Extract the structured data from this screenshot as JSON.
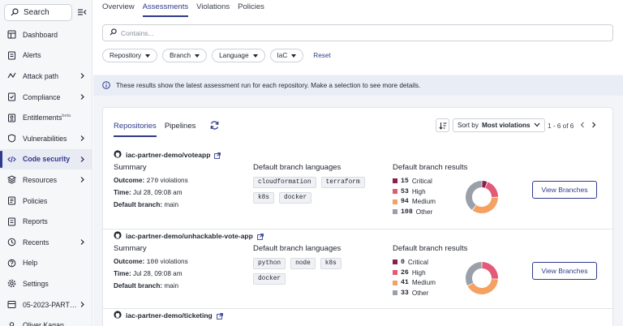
{
  "sidebar": {
    "search_label": "Search",
    "items": [
      {
        "label": "Dashboard",
        "icon": "dashboard-icon",
        "chevron": false
      },
      {
        "label": "Alerts",
        "icon": "alerts-icon",
        "chevron": false
      },
      {
        "label": "Attack path",
        "icon": "attack-path-icon",
        "chevron": true
      },
      {
        "label": "Compliance",
        "icon": "compliance-icon",
        "chevron": true
      },
      {
        "label": "Entitlements",
        "icon": "entitlements-icon",
        "chevron": false,
        "badge": "beta"
      },
      {
        "label": "Vulnerabilities",
        "icon": "vulnerabilities-icon",
        "chevron": true
      },
      {
        "label": "Code security",
        "icon": "code-icon",
        "chevron": true,
        "active": true
      },
      {
        "label": "Resources",
        "icon": "resources-icon",
        "chevron": true
      },
      {
        "label": "Policies",
        "icon": "policies-icon",
        "chevron": false
      },
      {
        "label": "Reports",
        "icon": "reports-icon",
        "chevron": false
      },
      {
        "label": "Recents",
        "icon": "recents-icon",
        "chevron": true
      },
      {
        "label": "Help",
        "icon": "help-icon",
        "chevron": false
      },
      {
        "label": "Settings",
        "icon": "settings-icon",
        "chevron": false
      },
      {
        "label": "05-2023-PART…",
        "icon": "tenant-icon",
        "chevron": true
      },
      {
        "label": "Oliver Kagan",
        "icon": "user-icon",
        "chevron": false
      }
    ]
  },
  "tabs": [
    "Overview",
    "Assessments",
    "Violations",
    "Policies"
  ],
  "active_tab": 1,
  "search": {
    "placeholder": "Contains..."
  },
  "filters": [
    "Repository",
    "Branch",
    "Language",
    "IaC"
  ],
  "reset_label": "Reset",
  "info_text": "These results show the latest assessment run for each repository. Make a selection to see more details.",
  "card": {
    "tabs": [
      "Repositories",
      "Pipelines"
    ],
    "sort_prefix": "Sort by",
    "sort_value": "Most violations",
    "pagination": "1 - 6 of 6"
  },
  "labels": {
    "summary": "Summary",
    "languages": "Default branch languages",
    "results": "Default branch results",
    "outcome": "Outcome:",
    "violations": "violations",
    "time": "Time:",
    "branch": "Default branch:",
    "view_branches": "View Branches"
  },
  "colors": {
    "critical": "#8a1f4e",
    "high": "#e25a78",
    "medium": "#f4a161",
    "other": "#9aa0aa",
    "accent": "#2f3a8c"
  },
  "repos": [
    {
      "name": "iac-partner-demo/voteapp",
      "outcome": "270",
      "time": "Jul 28, 09:08 am",
      "branch": "main",
      "languages": [
        "cloudformation",
        "terraform",
        "k8s",
        "docker"
      ],
      "results": [
        {
          "count": "15",
          "label": "Critical"
        },
        {
          "count": "53",
          "label": "High"
        },
        {
          "count": "94",
          "label": "Medium"
        },
        {
          "count": "108",
          "label": "Other"
        }
      ]
    },
    {
      "name": "iac-partner-demo/unhackable-vote-app",
      "outcome": "100",
      "time": "Jul 28, 09:08 am",
      "branch": "main",
      "languages": [
        "python",
        "node",
        "k8s",
        "docker"
      ],
      "results": [
        {
          "count": "0",
          "label": "Critical"
        },
        {
          "count": "26",
          "label": "High"
        },
        {
          "count": "41",
          "label": "Medium"
        },
        {
          "count": "33",
          "label": "Other"
        }
      ]
    },
    {
      "name": "iac-partner-demo/ticketing"
    }
  ]
}
